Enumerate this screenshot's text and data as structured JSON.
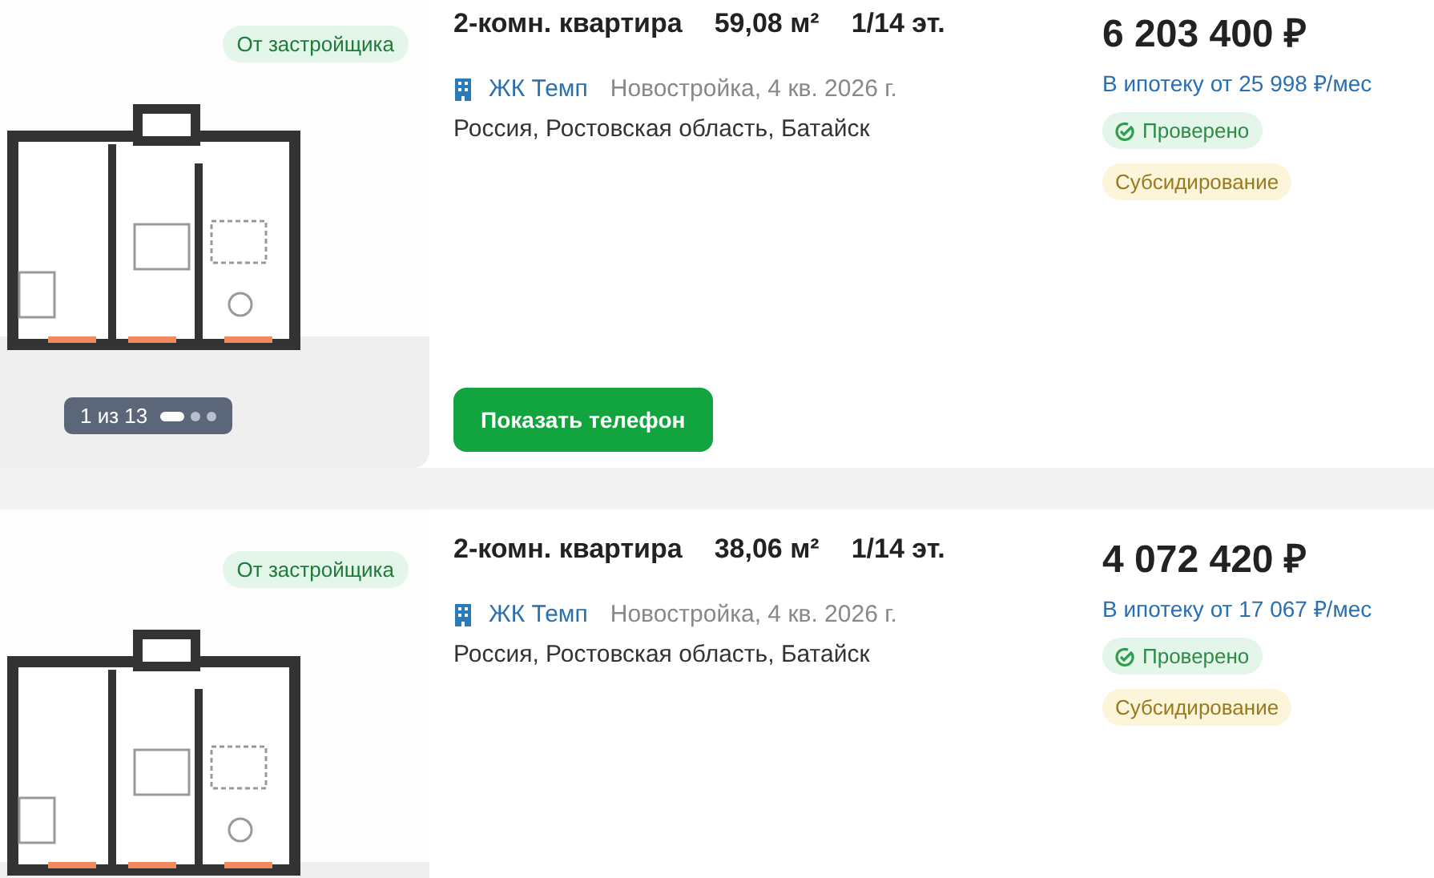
{
  "listings": [
    {
      "badge": "От застройщика",
      "pager": {
        "label": "1 из 13",
        "dots": [
          {
            "selected": true
          },
          {
            "selected": false
          },
          {
            "selected": false
          }
        ]
      },
      "title": "2-комн. квартира",
      "area": "59,08 м²",
      "floor": "1/14 эт.",
      "complex": "ЖК Темп",
      "status": "Новостройка, 4 кв. 2026 г.",
      "location": "Россия, Ростовская область, Батайск",
      "price": "6 203 400 ₽",
      "mortgage": "В ипотеку от 25 998 ₽/мес",
      "tags": [
        {
          "label": "Проверено",
          "kind": "verified"
        },
        {
          "label": "Субсидирование",
          "kind": "subsidy"
        }
      ],
      "phone_button": "Показать телефон"
    },
    {
      "badge": "От застройщика",
      "title": "2-комн. квартира",
      "area": "38,06 м²",
      "floor": "1/14 эт.",
      "complex": "ЖК Темп",
      "status": "Новостройка, 4 кв. 2026 г.",
      "location": "Россия, Ростовская область, Батайск",
      "price": "4 072 420 ₽",
      "mortgage": "В ипотеку от 17 067 ₽/мес",
      "tags": [
        {
          "label": "Проверено",
          "kind": "verified"
        },
        {
          "label": "Субсидирование",
          "kind": "subsidy"
        }
      ]
    }
  ]
}
